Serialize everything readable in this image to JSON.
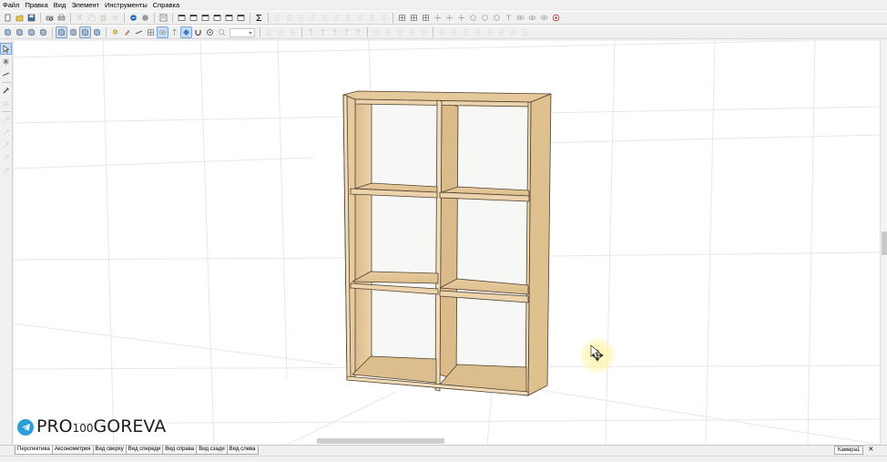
{
  "menu": [
    "Файл",
    "Правка",
    "Вид",
    "Элемент",
    "Инструменты",
    "Справка"
  ],
  "toolbar1": {
    "groups": [
      [
        "new-icon",
        "open-icon",
        "save-icon"
      ],
      [
        "print-preview-icon",
        "print-icon"
      ],
      [
        "cut-icon",
        "copy-icon",
        "paste-icon",
        "delete-icon"
      ],
      [
        "undo-icon",
        "redo-icon"
      ],
      [
        "properties-icon"
      ],
      [
        "view-window-icon",
        "view-window-icon",
        "view-window-icon",
        "view-window-icon",
        "view-window-icon",
        "view-window-icon"
      ],
      [
        "sigma-icon"
      ],
      [
        "align-icon",
        "align-icon",
        "align-icon",
        "align-icon",
        "align-icon",
        "align-icon",
        "align-icon",
        "align-icon",
        "align-icon",
        "align-icon"
      ],
      [
        "grid-icon",
        "grid-icon",
        "grid-icon",
        "move-icon",
        "move-icon",
        "move-icon",
        "rotate-icon",
        "rotate-icon",
        "rotate-icon",
        "text-icon",
        "eye-icon",
        "eye-icon",
        "eye-icon",
        "stop-icon"
      ]
    ]
  },
  "toolbar2": {
    "groups": [
      [
        "panel-icon",
        "panel-icon",
        "panel-icon",
        "panel-icon"
      ],
      [
        "panel-icon",
        "panel-icon",
        "panel-icon",
        "panel-icon"
      ],
      [
        "light-icon",
        "paint-icon",
        "measure-icon",
        "grid-icon",
        "eye-icon",
        "arrow-icon",
        "diamond-icon",
        "magnet-icon",
        "wheel-icon",
        "zoom-icon"
      ],
      [
        "align-icon",
        "align-icon",
        "align-icon"
      ],
      [
        "arrow-icon",
        "arrow-icon",
        "arrow-icon",
        "arrow-icon",
        "arrow-icon"
      ],
      [
        "align-icon",
        "align-icon",
        "align-icon",
        "align-icon",
        "align-icon"
      ],
      [
        "align-icon",
        "align-icon",
        "align-icon",
        "align-icon",
        "align-icon",
        "align-icon",
        "align-icon",
        "align-icon"
      ]
    ]
  },
  "left_tools": [
    "select-arrow-icon",
    "transform-icon",
    "measure-icon",
    "eyedropper-icon",
    "erase-icon",
    "tool-icon",
    "tool-icon",
    "tool-icon",
    "tool-icon",
    "tool-icon"
  ],
  "watermark": {
    "prefix": "PRO",
    "middle": "100",
    "suffix": "GOREVA"
  },
  "view_tabs": [
    "Перспектива",
    "Аксонометрия",
    "Вид сверху",
    "Вид спереди",
    "Вид справа",
    "Вид сзади",
    "Вид слева"
  ],
  "active_view_tab": 0,
  "camera_tab": {
    "label": "Камера1",
    "close": "✕"
  },
  "colors": {
    "wood_front": "#e9cfa6",
    "wood_top": "#e2c599",
    "wood_side": "#d7b788",
    "wood_shadow": "#c9a676",
    "edge": "#5a4a36",
    "accent_select": "#c9dcf2",
    "telegram_blue": "#2a9fd8",
    "cursor_halo": "#fff3a0"
  }
}
